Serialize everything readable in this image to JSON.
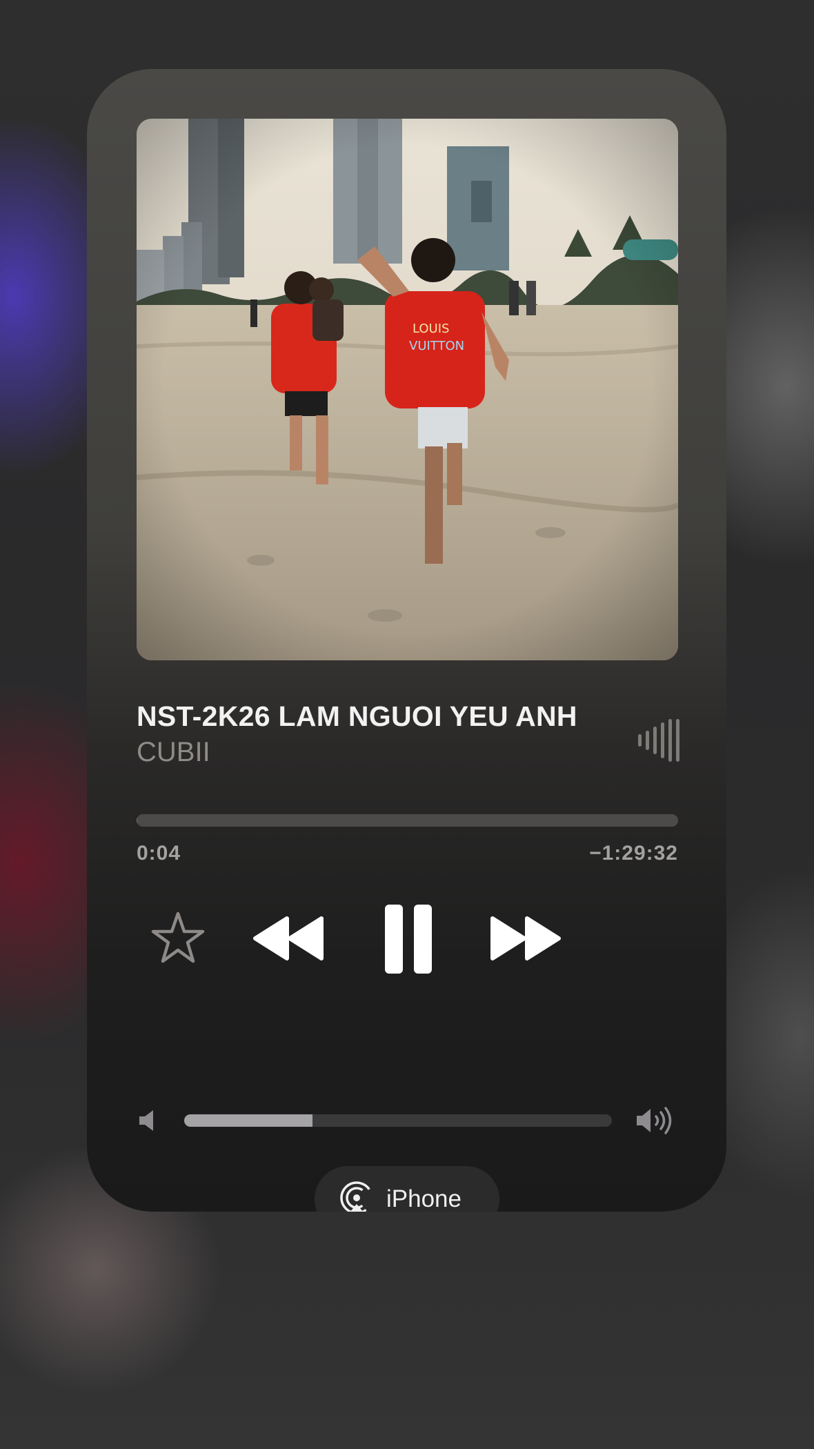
{
  "now_playing": {
    "title": "NST-2K26 LAM NGUOI YEU ANH",
    "artist": "CUBII",
    "elapsed": "0:04",
    "remaining": "−1:29:32",
    "progress_fraction": 0.0007
  },
  "controls": {
    "favorite_icon": "star-icon",
    "rewind_icon": "rewind-icon",
    "pause_icon": "pause-icon",
    "forward_icon": "fast-forward-icon"
  },
  "volume": {
    "level_fraction": 0.3,
    "low_icon": "speaker-low-icon",
    "high_icon": "speaker-high-icon"
  },
  "output": {
    "device_label": "iPhone",
    "icon": "airplay-icon"
  },
  "colors": {
    "accent_text": "#f2f2f2",
    "secondary_text": "#8f8c88"
  }
}
